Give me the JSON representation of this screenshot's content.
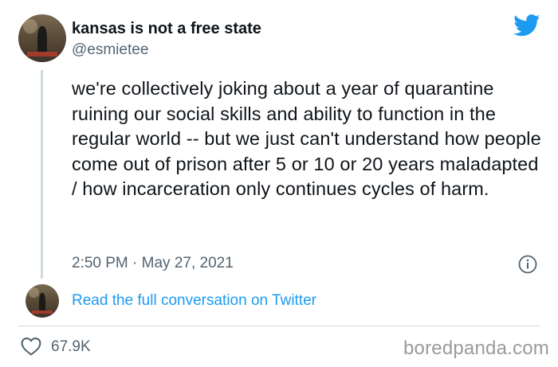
{
  "author": {
    "display_name": "kansas is not a free state",
    "handle": "@esmietee"
  },
  "tweet": {
    "text": "we're collectively joking about a year of quarantine ruining our social skills and ability to function in the regular world -- but we just can't understand how people come out of prison after 5 or 10 or 20 years maladapted / how incarceration only continues cycles of harm.",
    "timestamp": "2:50 PM · May 27, 2021"
  },
  "conversation_link": "Read the full conversation on Twitter",
  "likes": "67.9K",
  "watermark": "boredpanda.com",
  "icons": {
    "brand": "twitter-bird-icon",
    "info": "info-icon",
    "like": "heart-icon"
  },
  "colors": {
    "twitter_blue": "#1d9bf0",
    "text_primary": "#0f1419",
    "text_secondary": "#536471",
    "divider": "#cfd9de"
  }
}
